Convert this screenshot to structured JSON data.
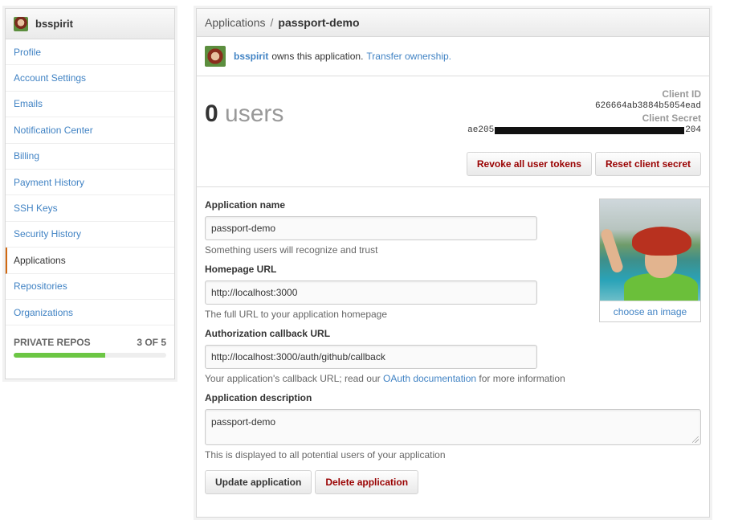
{
  "sidebar": {
    "username": "bsspirit",
    "items": [
      {
        "label": "Profile"
      },
      {
        "label": "Account Settings"
      },
      {
        "label": "Emails"
      },
      {
        "label": "Notification Center"
      },
      {
        "label": "Billing"
      },
      {
        "label": "Payment History"
      },
      {
        "label": "SSH Keys"
      },
      {
        "label": "Security History"
      },
      {
        "label": "Applications",
        "selected": true
      },
      {
        "label": "Repositories"
      },
      {
        "label": "Organizations"
      }
    ],
    "private_repos": {
      "label": "PRIVATE REPOS",
      "count": "3 OF 5",
      "progress": 0.6
    }
  },
  "header": {
    "breadcrumb_root": "Applications",
    "separator": "/",
    "app_name": "passport-demo"
  },
  "owner": {
    "username": "bsspirit",
    "text": "owns this application.",
    "transfer_link": "Transfer ownership."
  },
  "stats": {
    "users_count": "0",
    "users_label": "users",
    "client_id_label": "Client ID",
    "client_id": "626664ab3884b5054ead",
    "client_secret_label": "Client Secret",
    "client_secret_prefix": "ae205",
    "client_secret_suffix": "204",
    "revoke_button": "Revoke all user tokens",
    "reset_button": "Reset client secret"
  },
  "form": {
    "name_label": "Application name",
    "name_value": "passport-demo",
    "name_hint": "Something users will recognize and trust",
    "homepage_label": "Homepage URL",
    "homepage_value": "http://localhost:3000",
    "homepage_hint": "The full URL to your application homepage",
    "callback_label": "Authorization callback URL",
    "callback_value": "http://localhost:3000/auth/github/callback",
    "callback_hint_pre": "Your application's callback URL; read our",
    "callback_hint_link": "OAuth documentation",
    "callback_hint_post": "for more information",
    "description_label": "Application description",
    "description_value": "passport-demo",
    "description_hint": "This is displayed to all potential users of your application",
    "update_button": "Update application",
    "delete_button": "Delete application",
    "choose_image": "choose an image"
  },
  "colors": {
    "link": "#4183c4",
    "danger": "#990000",
    "progress": "#6cc644",
    "selected_marker": "#d26911"
  }
}
